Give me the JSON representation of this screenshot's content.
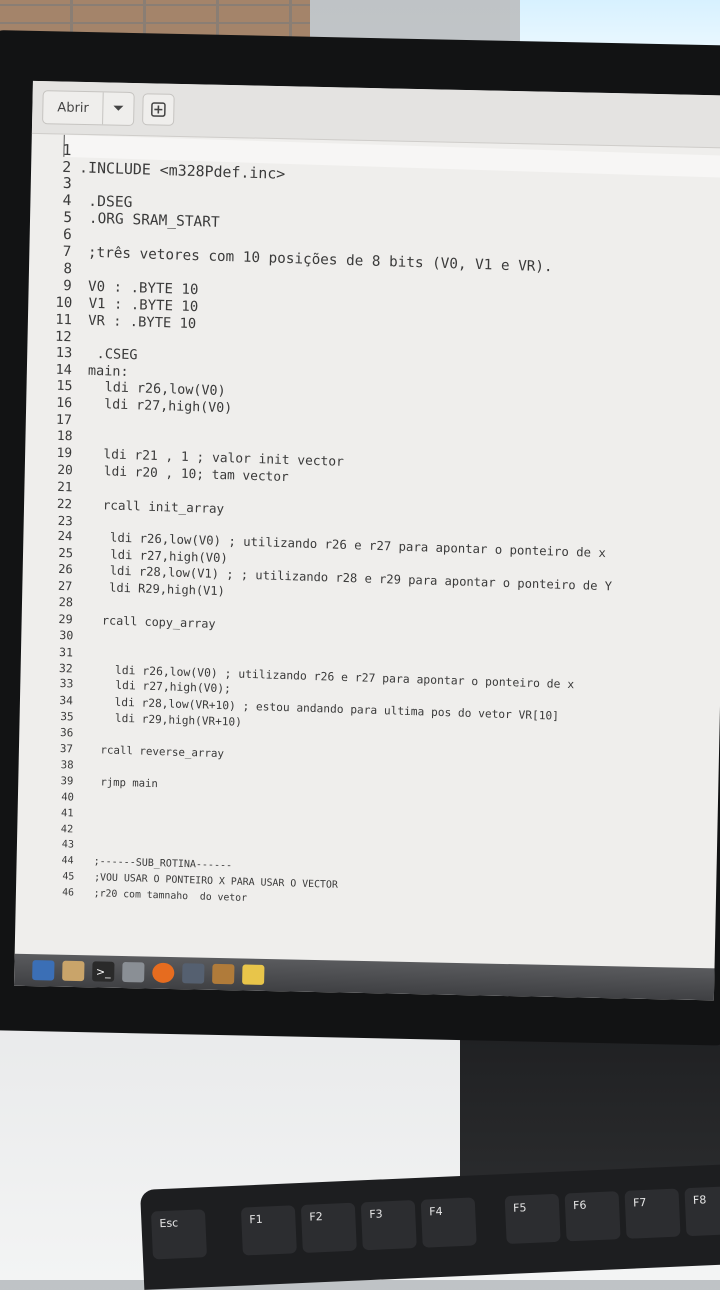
{
  "toolbar": {
    "open_label": "Abrir",
    "open_menu_icon": "chevron-down-icon",
    "new_tab_icon": "plus-box-icon"
  },
  "editor": {
    "lines": [
      {
        "n": "1",
        "code": ""
      },
      {
        "n": "2",
        "code": ".INCLUDE <m328Pdef.inc>"
      },
      {
        "n": "3",
        "code": ""
      },
      {
        "n": "4",
        "code": " .DSEG"
      },
      {
        "n": "5",
        "code": " .ORG SRAM_START"
      },
      {
        "n": "6",
        "code": ""
      },
      {
        "n": "7",
        "code": " ;três vetores com 10 posições de 8 bits (V0, V1 e VR)."
      },
      {
        "n": "8",
        "code": ""
      },
      {
        "n": "9",
        "code": " V0 : .BYTE 10"
      },
      {
        "n": "10",
        "code": " V1 : .BYTE 10"
      },
      {
        "n": "11",
        "code": " VR : .BYTE 10"
      },
      {
        "n": "12",
        "code": ""
      },
      {
        "n": "13",
        "code": "  .CSEG"
      },
      {
        "n": "14",
        "code": " main:"
      },
      {
        "n": "15",
        "code": "   ldi r26,low(V0)"
      },
      {
        "n": "16",
        "code": "   ldi r27,high(V0)"
      },
      {
        "n": "17",
        "code": ""
      },
      {
        "n": "18",
        "code": ""
      },
      {
        "n": "19",
        "code": "   ldi r21 , 1 ; valor init vector"
      },
      {
        "n": "20",
        "code": "   ldi r20 , 10; tam vector"
      },
      {
        "n": "21",
        "code": ""
      },
      {
        "n": "22",
        "code": "   rcall init_array"
      },
      {
        "n": "23",
        "code": ""
      },
      {
        "n": "24",
        "code": "    ldi r26,low(V0) ; utilizando r26 e r27 para apontar o ponteiro de x"
      },
      {
        "n": "25",
        "code": "    ldi r27,high(V0)"
      },
      {
        "n": "26",
        "code": "    ldi r28,low(V1) ; ; utilizando r28 e r29 para apontar o ponteiro de Y"
      },
      {
        "n": "27",
        "code": "    ldi R29,high(V1)"
      },
      {
        "n": "28",
        "code": ""
      },
      {
        "n": "29",
        "code": "   rcall copy_array"
      },
      {
        "n": "30",
        "code": ""
      },
      {
        "n": "31",
        "code": ""
      },
      {
        "n": "32",
        "code": "     ldi r26,low(V0) ; utilizando r26 e r27 para apontar o ponteiro de x"
      },
      {
        "n": "33",
        "code": "     ldi r27,high(V0);"
      },
      {
        "n": "34",
        "code": "     ldi r28,low(VR+10) ; estou andando para ultima pos do vetor VR[10]"
      },
      {
        "n": "35",
        "code": "     ldi r29,high(VR+10)"
      },
      {
        "n": "36",
        "code": ""
      },
      {
        "n": "37",
        "code": "   rcall reverse_array"
      },
      {
        "n": "38",
        "code": ""
      },
      {
        "n": "39",
        "code": "   rjmp main"
      },
      {
        "n": "40",
        "code": ""
      },
      {
        "n": "41",
        "code": ""
      },
      {
        "n": "42",
        "code": ""
      },
      {
        "n": "43",
        "code": ""
      },
      {
        "n": "44",
        "code": "  ;------SUB_ROTINA------"
      },
      {
        "n": "45",
        "code": "  ;VOU USAR O PONTEIRO X PARA USAR O VECTOR"
      },
      {
        "n": "46",
        "code": "  ;r20 com tamnaho  do vetor"
      }
    ]
  },
  "taskbar": {
    "icons": [
      "gauge-icon",
      "folder-icon",
      "terminal-icon",
      "save-icon",
      "firefox-icon",
      "calculator-icon",
      "archive-icon",
      "text-editor-icon"
    ],
    "colors": [
      "#3b6fb6",
      "#c9a46a",
      "#2a2a2a",
      "#8a8f95",
      "#e66c1f",
      "#556070",
      "#b07b3a",
      "#e8c54a"
    ]
  },
  "keyboard": {
    "keys": [
      "Esc",
      "F1",
      "F2",
      "F3",
      "F4",
      "F5",
      "F6",
      "F7",
      "F8"
    ]
  }
}
